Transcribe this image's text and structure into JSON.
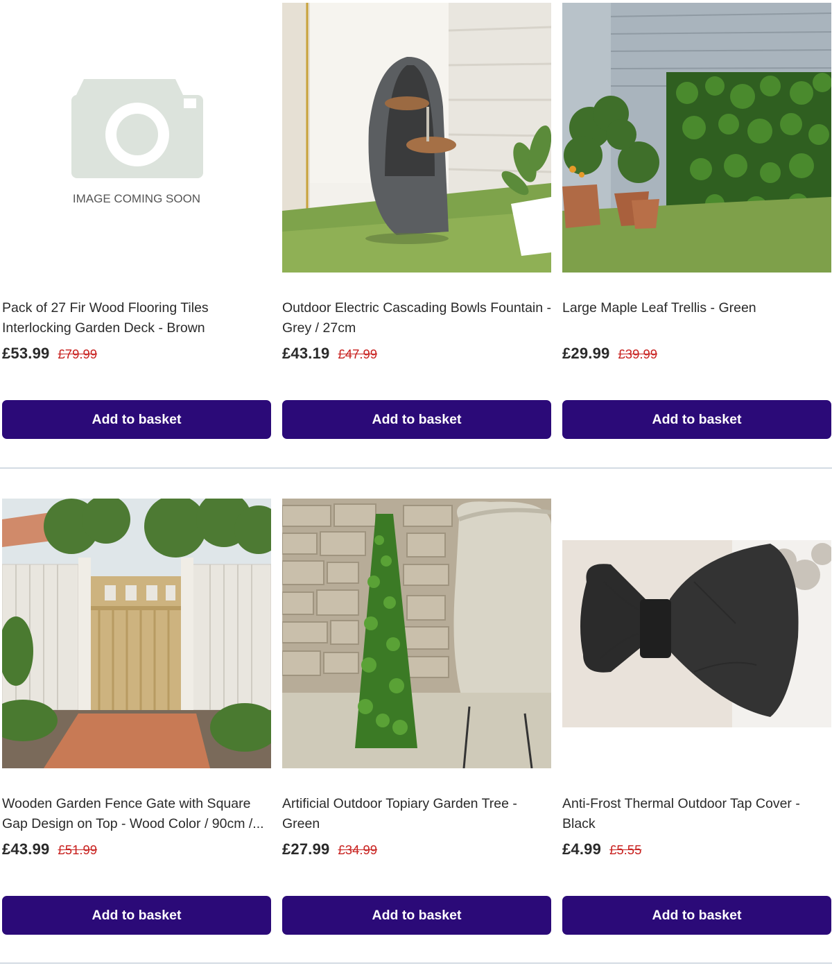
{
  "button_label": "Add to basket",
  "placeholder_text": "IMAGE COMING SOON",
  "products": [
    {
      "title_lines": [
        "Pack of 27 Fir Wood Flooring Tiles",
        "Interlocking Garden Deck - Brown"
      ],
      "price": "£53.99",
      "was_price": "£79.99",
      "image": "placeholder-image"
    },
    {
      "title_lines": [
        "Outdoor Electric Cascading Bowls Fountain -",
        "Grey / 27cm"
      ],
      "price": "£43.19",
      "was_price": "£47.99",
      "image": "fountain-photo"
    },
    {
      "title_lines": [
        "Large Maple Leaf Trellis - Green",
        ""
      ],
      "price": "£29.99",
      "was_price": "£39.99",
      "image": "trellis-photo"
    },
    {
      "title_lines": [
        "Wooden Garden Fence Gate with Square",
        "Gap Design on Top - Wood Color / 90cm /..."
      ],
      "price": "£43.99",
      "was_price": "£51.99",
      "image": "gate-photo"
    },
    {
      "title_lines": [
        "Artificial Outdoor Topiary Garden Tree -",
        "Green"
      ],
      "price": "£27.99",
      "was_price": "£34.99",
      "image": "topiary-photo"
    },
    {
      "title_lines": [
        "Anti-Frost Thermal Outdoor Tap Cover -",
        "Black"
      ],
      "price": "£4.99",
      "was_price": "£5.55",
      "image": "tap-cover-photo"
    }
  ],
  "colors": {
    "button": "#2b0a78",
    "was_price": "#c8201e",
    "divider": "#d3dbe3"
  }
}
